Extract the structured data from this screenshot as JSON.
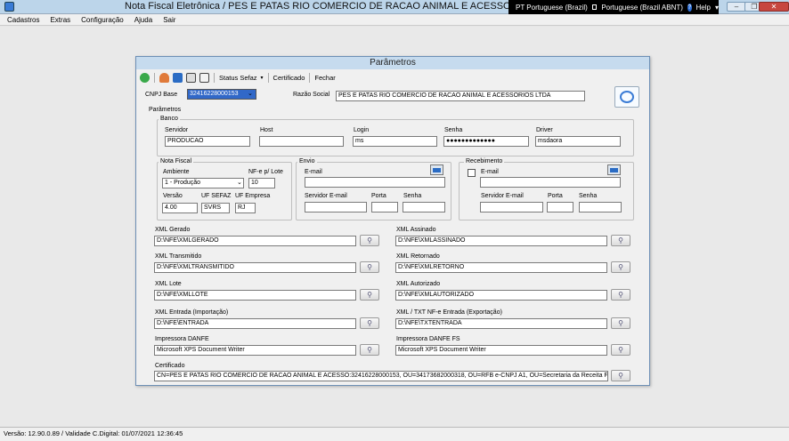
{
  "window": {
    "title": "Nota Fiscal Eletrônica / PES E PATAS RIO COMERCIO DE RACAO ANIMAL E ACESSORIOS LTDA"
  },
  "langbar": {
    "lang": "PT Portuguese (Brazil)",
    "keyboard": "Portuguese (Brazil ABNT)",
    "help": "Help"
  },
  "menu": [
    "Cadastros",
    "Extras",
    "Configuração",
    "Ajuda",
    "Sair"
  ],
  "dialog": {
    "title": "Parâmetros",
    "toolbar": {
      "status_sefaz": "Status Sefaz",
      "certificado": "Certificado",
      "fechar": "Fechar"
    },
    "cnpj_base_label": "CNPJ Base",
    "cnpj_base_value": "32416228000153",
    "razao_social_label": "Razão Social",
    "razao_social_value": "PES E PATAS RIO COMERCIO DE RACAO ANIMAL E ACESSORIOS LTDA",
    "parametros_label": "Parâmetros",
    "banco": {
      "title": "Banco",
      "servidor_label": "Servidor",
      "servidor_value": "PRODUCAO",
      "host_label": "Host",
      "host_value": "",
      "login_label": "Login",
      "login_value": "ms",
      "senha_label": "Senha",
      "senha_value": "●●●●●●●●●●●●●",
      "driver_label": "Driver",
      "driver_value": "msdaora"
    },
    "nota_fiscal": {
      "title": "Nota Fiscal",
      "ambiente_label": "Ambiente",
      "ambiente_value": "1 - Produção",
      "nfe_lote_label": "NF-e p/ Lote",
      "nfe_lote_value": "10",
      "versao_label": "Versão",
      "versao_value": "4.00",
      "uf_sefaz_label": "UF SEFAZ",
      "uf_sefaz_value": "SVRS",
      "uf_empresa_label": "UF Empresa",
      "uf_empresa_value": "RJ"
    },
    "envio": {
      "title": "Envio",
      "email_label": "E-mail",
      "email_value": "",
      "servidor_label": "Servidor E-mail",
      "porta_label": "Porta",
      "senha_label": "Senha"
    },
    "recebimento": {
      "title": "Recebimento",
      "email_label": "E-mail",
      "email_value": "",
      "servidor_label": "Servidor E-mail",
      "porta_label": "Porta",
      "senha_label": "Senha"
    },
    "paths": {
      "xml_gerado_label": "XML Gerado",
      "xml_gerado_value": "D:\\NFE\\XMLGERADO",
      "xml_assinado_label": "XML Assinado",
      "xml_assinado_value": "D:\\NFE\\XMLASSINADO",
      "xml_transmitido_label": "XML Transmitido",
      "xml_transmitido_value": "D:\\NFE\\XMLTRANSMITIDO",
      "xml_retornado_label": "XML Retornado",
      "xml_retornado_value": "D:\\NFE\\XMLRETORNO",
      "xml_lote_label": "XML Lote",
      "xml_lote_value": "D:\\NFE\\XMLLOTE",
      "xml_autorizado_label": "XML Autorizado",
      "xml_autorizado_value": "D:\\NFE\\XMLAUTORIZADO",
      "xml_entrada_label": "XML Entrada (Importação)",
      "xml_entrada_value": "D:\\NFE\\ENTRADA",
      "xml_txt_label": "XML / TXT NF-e Entrada (Exportação)",
      "xml_txt_value": "D:\\NFE\\TXTENTRADA",
      "impressora_label": "Impressora DANFE",
      "impressora_value": "Microsoft XPS Document Writer",
      "impressora_fs_label": "Impressora DANFE FS",
      "impressora_fs_value": "Microsoft XPS Document Writer",
      "certificado_label": "Certificado",
      "certificado_value": "CN=PES E PATAS RIO COMERCIO DE RACAO ANIMAL E ACESSO:32416228000153, OU=34173682000318, OU=RFB e-CNPJ A1, OU=Secretaria da Receita Fed"
    }
  },
  "status": {
    "text": "Versão: 12.90.0.89 / Validade C.Digital: 01/07/2021 12:36:45"
  },
  "colors": {
    "titlebar": "#bcd5ea",
    "dialog_title": "#c6dbee",
    "accent": "#3a7bd5",
    "close": "#c7463f"
  }
}
